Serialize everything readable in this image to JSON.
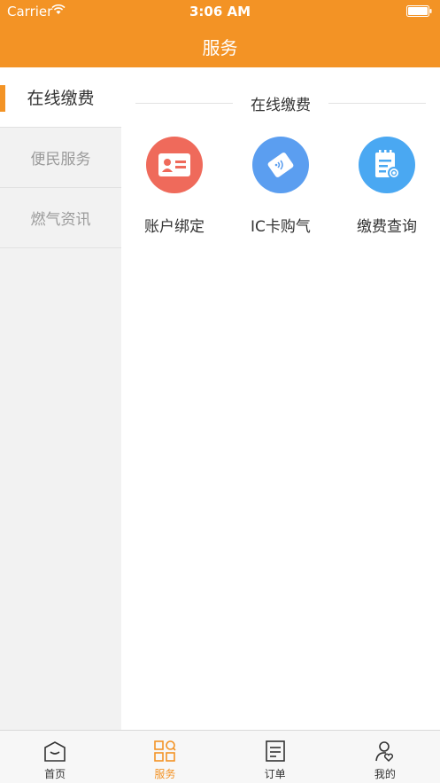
{
  "status_bar": {
    "carrier": "Carrier",
    "time": "3:06 AM"
  },
  "nav": {
    "title": "服务"
  },
  "sidebar": {
    "items": [
      {
        "label": "在线缴费",
        "active": true
      },
      {
        "label": "便民服务",
        "active": false
      },
      {
        "label": "燃气资讯",
        "active": false
      }
    ]
  },
  "main": {
    "section_title": "在线缴费",
    "services": [
      {
        "label": "账户绑定",
        "icon": "id-card-icon",
        "color": "#ef6a5b"
      },
      {
        "label": "IC卡购气",
        "icon": "ic-card-icon",
        "color": "#5b9ef0"
      },
      {
        "label": "缴费查询",
        "icon": "bill-search-icon",
        "color": "#4aa8f2"
      }
    ]
  },
  "tabbar": {
    "tabs": [
      {
        "label": "首页",
        "icon": "home-icon",
        "active": false
      },
      {
        "label": "服务",
        "icon": "grid-icon",
        "active": true
      },
      {
        "label": "订单",
        "icon": "order-icon",
        "active": false
      },
      {
        "label": "我的",
        "icon": "profile-icon",
        "active": false
      }
    ]
  },
  "colors": {
    "accent": "#f39325",
    "sidebar_bg": "#f2f2f2"
  }
}
